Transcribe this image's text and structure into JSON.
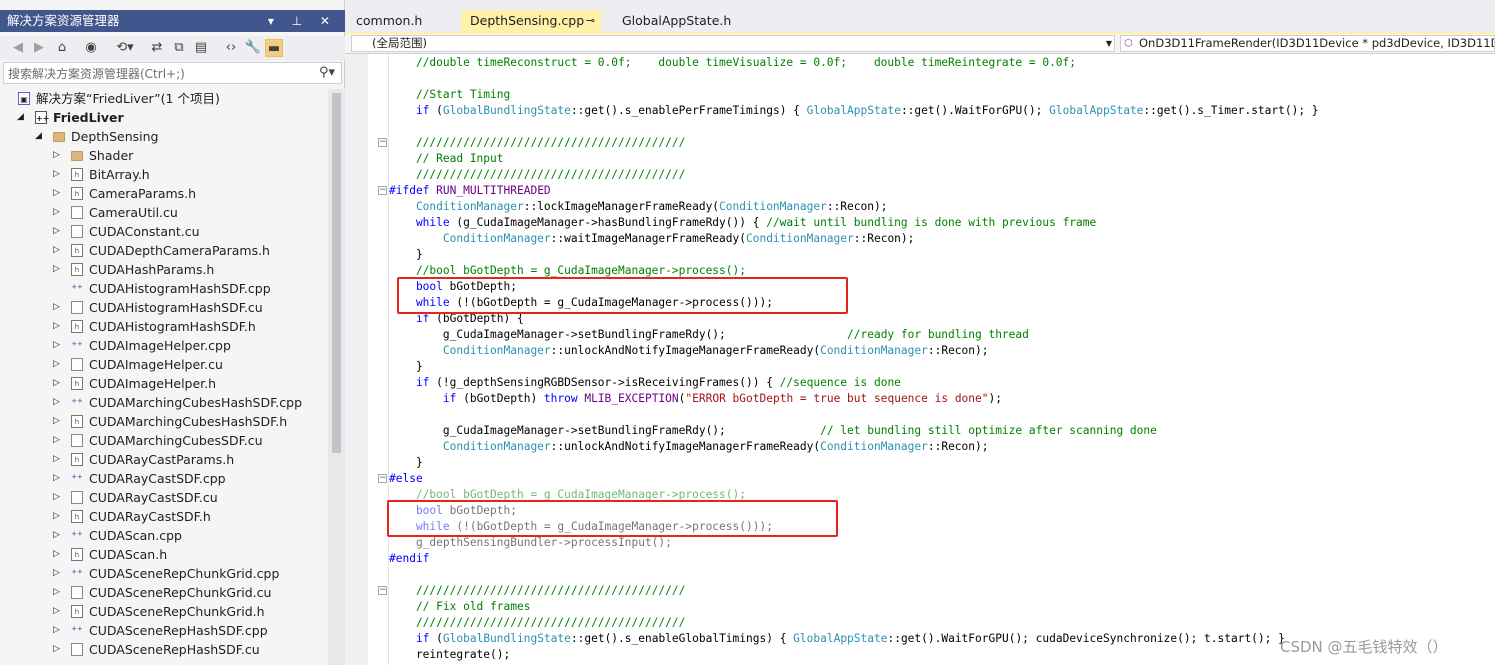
{
  "solution_explorer": {
    "title": "解决方案资源管理器",
    "title_controls": "▾ ⊥ ✕",
    "search_placeholder": "搜索解决方案资源管理器(Ctrl+;)",
    "tree": [
      {
        "label": "解决方案“FriedLiver”(1 个项目)",
        "icon": "solution-icon",
        "level": 0,
        "arrow": ""
      },
      {
        "label": "FriedLiver",
        "icon": "project-icon",
        "level": 1,
        "arrow": "◢",
        "bold": true
      },
      {
        "label": "DepthSensing",
        "icon": "folder-icon",
        "level": 2,
        "arrow": "◢"
      },
      {
        "label": "Shader",
        "icon": "folder-icon",
        "level": 3,
        "arrow": "▷"
      },
      {
        "label": "BitArray.h",
        "icon": "header-file-icon",
        "level": 3,
        "arrow": "▷"
      },
      {
        "label": "CameraParams.h",
        "icon": "header-file-icon",
        "level": 3,
        "arrow": "▷"
      },
      {
        "label": "CameraUtil.cu",
        "icon": "cu-file-icon",
        "level": 3,
        "arrow": "▷"
      },
      {
        "label": "CUDAConstant.cu",
        "icon": "cu-file-icon",
        "level": 3,
        "arrow": "▷"
      },
      {
        "label": "CUDADepthCameraParams.h",
        "icon": "header-file-icon",
        "level": 3,
        "arrow": "▷"
      },
      {
        "label": "CUDAHashParams.h",
        "icon": "header-file-icon",
        "level": 3,
        "arrow": "▷"
      },
      {
        "label": "CUDAHistogramHashSDF.cpp",
        "icon": "cpp-file-icon",
        "level": 3,
        "arrow": ""
      },
      {
        "label": "CUDAHistogramHashSDF.cu",
        "icon": "cu-file-icon",
        "level": 3,
        "arrow": "▷"
      },
      {
        "label": "CUDAHistogramHashSDF.h",
        "icon": "header-file-icon",
        "level": 3,
        "arrow": "▷"
      },
      {
        "label": "CUDAImageHelper.cpp",
        "icon": "cpp-file-icon",
        "level": 3,
        "arrow": "▷"
      },
      {
        "label": "CUDAImageHelper.cu",
        "icon": "cu-file-icon",
        "level": 3,
        "arrow": "▷"
      },
      {
        "label": "CUDAImageHelper.h",
        "icon": "header-file-icon",
        "level": 3,
        "arrow": "▷"
      },
      {
        "label": "CUDAMarchingCubesHashSDF.cpp",
        "icon": "cpp-file-icon",
        "level": 3,
        "arrow": "▷"
      },
      {
        "label": "CUDAMarchingCubesHashSDF.h",
        "icon": "header-file-icon",
        "level": 3,
        "arrow": "▷"
      },
      {
        "label": "CUDAMarchingCubesSDF.cu",
        "icon": "cu-file-icon",
        "level": 3,
        "arrow": "▷"
      },
      {
        "label": "CUDARayCastParams.h",
        "icon": "header-file-icon",
        "level": 3,
        "arrow": "▷"
      },
      {
        "label": "CUDARayCastSDF.cpp",
        "icon": "cpp-file-icon",
        "level": 3,
        "arrow": "▷"
      },
      {
        "label": "CUDARayCastSDF.cu",
        "icon": "cu-file-icon",
        "level": 3,
        "arrow": "▷"
      },
      {
        "label": "CUDARayCastSDF.h",
        "icon": "header-file-icon",
        "level": 3,
        "arrow": "▷"
      },
      {
        "label": "CUDAScan.cpp",
        "icon": "cpp-file-icon",
        "level": 3,
        "arrow": "▷"
      },
      {
        "label": "CUDAScan.h",
        "icon": "header-file-icon",
        "level": 3,
        "arrow": "▷"
      },
      {
        "label": "CUDASceneRepChunkGrid.cpp",
        "icon": "cpp-file-icon",
        "level": 3,
        "arrow": "▷"
      },
      {
        "label": "CUDASceneRepChunkGrid.cu",
        "icon": "cu-file-icon",
        "level": 3,
        "arrow": "▷"
      },
      {
        "label": "CUDASceneRepChunkGrid.h",
        "icon": "header-file-icon",
        "level": 3,
        "arrow": "▷"
      },
      {
        "label": "CUDASceneRepHashSDF.cpp",
        "icon": "cpp-file-icon",
        "level": 3,
        "arrow": "▷"
      },
      {
        "label": "CUDASceneRepHashSDF.cu",
        "icon": "cu-file-icon",
        "level": 3,
        "arrow": "▷"
      }
    ]
  },
  "editor": {
    "tabs": [
      {
        "label": "common.h",
        "active": false
      },
      {
        "label": "DepthSensing.cpp",
        "active": true,
        "pin": "⊸"
      },
      {
        "label": "GlobalAppState.h",
        "active": false
      }
    ],
    "scope_label": "(全局范围)",
    "function_label": "OnD3D11FrameRender(ID3D11Device * pd3dDevice, ID3D11D",
    "code_lines": [
      [
        [
          "c",
          "    //double timeReconstruct = 0.0f;    double timeVisualize = 0.0f;    double timeReintegrate = 0.0f;"
        ]
      ],
      [
        [
          "",
          ""
        ]
      ],
      [
        [
          "c",
          "    //Start Timing"
        ]
      ],
      [
        [
          "k",
          "    if"
        ],
        [
          "",
          " ("
        ],
        [
          "t",
          "GlobalBundlingState"
        ],
        [
          "",
          "::get().s_enablePerFrameTimings) { "
        ],
        [
          "t",
          "GlobalAppState"
        ],
        [
          "",
          "::get().WaitForGPU(); "
        ],
        [
          "t",
          "GlobalAppState"
        ],
        [
          "",
          "::get().s_Timer.start(); }"
        ]
      ],
      [
        [
          "",
          ""
        ]
      ],
      [
        [
          "c",
          "    ////////////////////////////////////////"
        ]
      ],
      [
        [
          "c",
          "    // Read Input"
        ]
      ],
      [
        [
          "c",
          "    ////////////////////////////////////////"
        ]
      ],
      [
        [
          "k",
          "#ifdef"
        ],
        [
          "m",
          " RUN_MULTITHREADED"
        ]
      ],
      [
        [
          "t",
          "    ConditionManager"
        ],
        [
          "",
          "::lockImageManagerFrameReady("
        ],
        [
          "t",
          "ConditionManager"
        ],
        [
          "",
          "::Recon);"
        ]
      ],
      [
        [
          "k",
          "    while"
        ],
        [
          "",
          " (g_CudaImageManager->hasBundlingFrameRdy()) { "
        ],
        [
          "c",
          "//wait until bundling is done with previous frame"
        ]
      ],
      [
        [
          "t",
          "        ConditionManager"
        ],
        [
          "",
          "::waitImageManagerFrameReady("
        ],
        [
          "t",
          "ConditionManager"
        ],
        [
          "",
          "::Recon);"
        ]
      ],
      [
        [
          "",
          "    }"
        ]
      ],
      [
        [
          "c",
          "    //bool bGotDepth = g_CudaImageManager->process();"
        ]
      ],
      [
        [
          "k",
          "    bool"
        ],
        [
          "",
          " bGotDepth;"
        ]
      ],
      [
        [
          "k",
          "    while"
        ],
        [
          "",
          " (!(bGotDepth = g_CudaImageManager->process()));"
        ]
      ],
      [
        [
          "k",
          "    if"
        ],
        [
          "",
          " (bGotDepth) {"
        ]
      ],
      [
        [
          "",
          "        g_CudaImageManager->setBundlingFrameRdy();                  "
        ],
        [
          "c",
          "//ready for bundling thread"
        ]
      ],
      [
        [
          "t",
          "        ConditionManager"
        ],
        [
          "",
          "::unlockAndNotifyImageManagerFrameReady("
        ],
        [
          "t",
          "ConditionManager"
        ],
        [
          "",
          "::Recon);"
        ]
      ],
      [
        [
          "",
          "    }"
        ]
      ],
      [
        [
          "k",
          "    if"
        ],
        [
          "",
          " (!g_depthSensingRGBDSensor->isReceivingFrames()) { "
        ],
        [
          "c",
          "//sequence is done"
        ]
      ],
      [
        [
          "k",
          "        if"
        ],
        [
          "",
          " (bGotDepth) "
        ],
        [
          "k",
          "throw"
        ],
        [
          "m",
          " MLIB_EXCEPTION"
        ],
        [
          "",
          "("
        ],
        [
          "s",
          "\"ERROR bGotDepth = true but sequence is done\""
        ],
        [
          "",
          ");"
        ]
      ],
      [
        [
          "",
          ""
        ]
      ],
      [
        [
          "",
          "        g_CudaImageManager->setBundlingFrameRdy();              "
        ],
        [
          "c",
          "// let bundling still optimize after scanning done"
        ]
      ],
      [
        [
          "t",
          "        ConditionManager"
        ],
        [
          "",
          "::unlockAndNotifyImageManagerFrameReady("
        ],
        [
          "t",
          "ConditionManager"
        ],
        [
          "",
          "::Recon);"
        ]
      ],
      [
        [
          "",
          "    }"
        ]
      ],
      [
        [
          "k",
          "#else"
        ]
      ],
      [
        [
          "c",
          "    //bool bGotDepth = g_CudaImageManager->process();"
        ]
      ],
      [
        [
          "k",
          "    bool"
        ],
        [
          "",
          " bGotDepth;"
        ]
      ],
      [
        [
          "k",
          "    while"
        ],
        [
          "",
          " (!(bGotDepth = g_CudaImageManager->process()));"
        ]
      ],
      [
        [
          "",
          "    g_depthSensingBundler->processInput();"
        ]
      ],
      [
        [
          "k",
          "#endif"
        ]
      ],
      [
        [
          "",
          ""
        ]
      ],
      [
        [
          "c",
          "    ////////////////////////////////////////"
        ]
      ],
      [
        [
          "c",
          "    // Fix old frames"
        ]
      ],
      [
        [
          "c",
          "    ////////////////////////////////////////"
        ]
      ],
      [
        [
          "k",
          "    if"
        ],
        [
          "",
          " ("
        ],
        [
          "t",
          "GlobalBundlingState"
        ],
        [
          "",
          "::get().s_enableGlobalTimings) { "
        ],
        [
          "t",
          "GlobalAppState"
        ],
        [
          "",
          "::get().WaitForGPU(); cudaDeviceSynchronize(); t.start(); }"
        ]
      ],
      [
        [
          "",
          "    reintegrate();"
        ]
      ]
    ]
  },
  "watermark": "CSDN @五毛钱特效（）"
}
